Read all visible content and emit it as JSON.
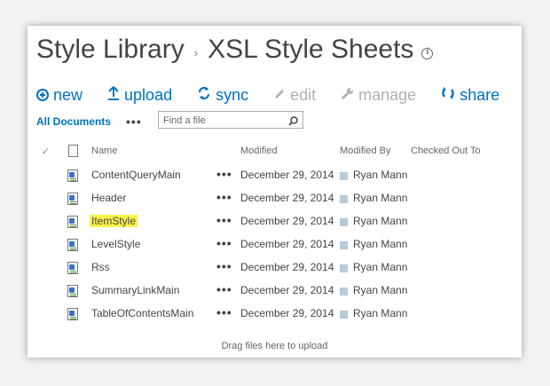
{
  "breadcrumb": {
    "parent": "Style Library",
    "separator": "›",
    "current": "XSL Style Sheets"
  },
  "toolbar": {
    "new_label": "new",
    "upload_label": "upload",
    "sync_label": "sync",
    "edit_label": "edit",
    "manage_label": "manage",
    "share_label": "share"
  },
  "view": {
    "name": "All Documents",
    "more": "•••"
  },
  "search": {
    "placeholder": "Find a file"
  },
  "columns": {
    "check": "✓",
    "name": "Name",
    "modified": "Modified",
    "modified_by": "Modified By",
    "checked_out_to": "Checked Out To"
  },
  "files": [
    {
      "name": "ContentQueryMain",
      "modified": "December 29, 2014",
      "modified_by": "Ryan Mann",
      "dots": "•••"
    },
    {
      "name": "Header",
      "modified": "December 29, 2014",
      "modified_by": "Ryan Mann",
      "dots": "•••"
    },
    {
      "name": "ItemStyle",
      "modified": "December 29, 2014",
      "modified_by": "Ryan Mann",
      "dots": "•••",
      "highlighted": true
    },
    {
      "name": "LevelStyle",
      "modified": "December 29, 2014",
      "modified_by": "Ryan Mann",
      "dots": "•••"
    },
    {
      "name": "Rss",
      "modified": "December 29, 2014",
      "modified_by": "Ryan Mann",
      "dots": "•••"
    },
    {
      "name": "SummaryLinkMain",
      "modified": "December 29, 2014",
      "modified_by": "Ryan Mann",
      "dots": "•••"
    },
    {
      "name": "TableOfContentsMain",
      "modified": "December 29, 2014",
      "modified_by": "Ryan Mann",
      "dots": "•••"
    }
  ],
  "dropzone": {
    "text": "Drag files here to upload"
  },
  "colors": {
    "accent": "#0072c6",
    "disabled": "#b1b1b1",
    "highlight": "#fbf34a"
  },
  "icons": {
    "info": "info-icon",
    "new": "plus-circle-icon",
    "upload": "upload-arrow-icon",
    "sync": "sync-icon",
    "edit": "pencil-icon",
    "manage": "wrench-icon",
    "share": "share-icon",
    "search": "magnifier-icon",
    "file": "xsl-file-icon"
  }
}
